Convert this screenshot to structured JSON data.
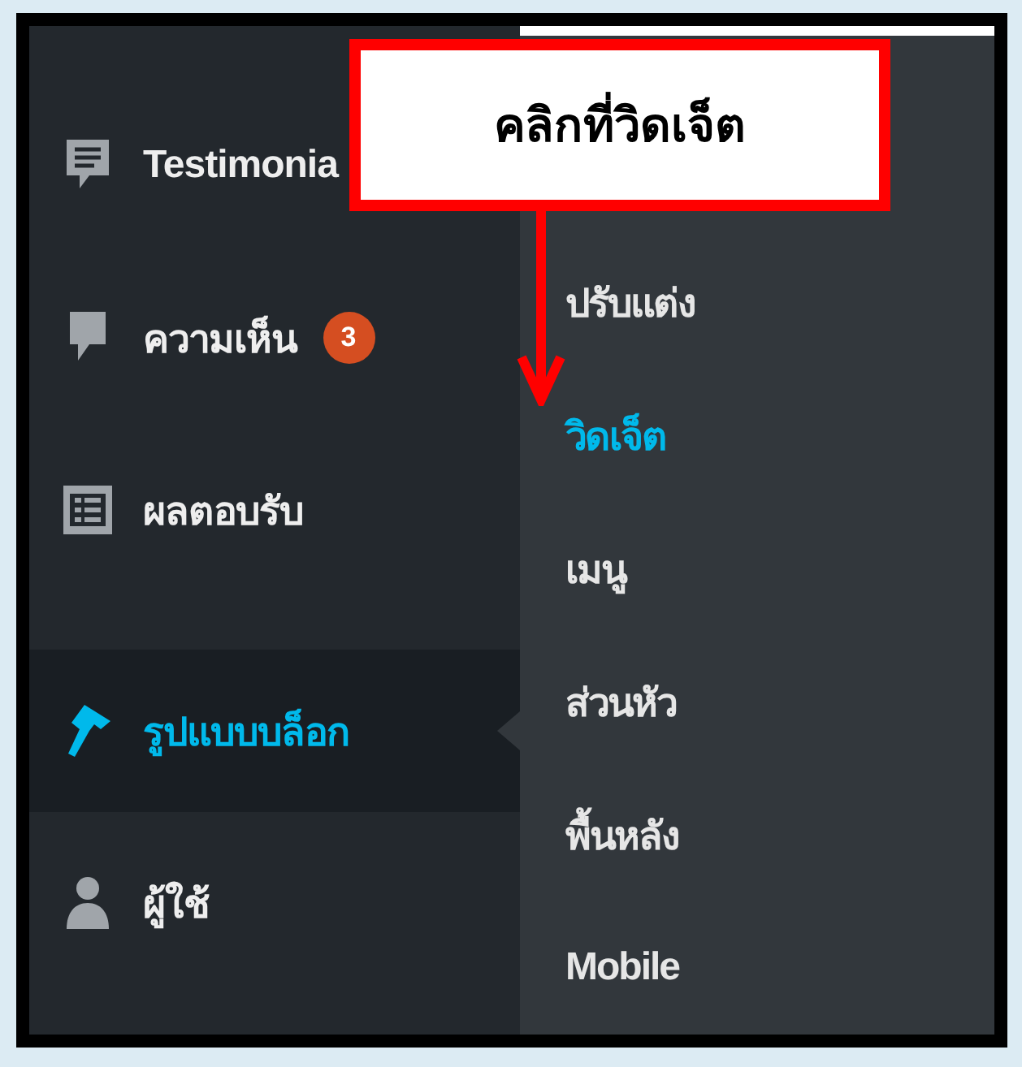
{
  "annotation": {
    "text": "คลิกที่วิดเจ็ต"
  },
  "sidebar": {
    "groups": [
      {
        "items": [
          {
            "label": "Testimonia",
            "kind": "testimonial",
            "selected": false
          },
          {
            "label": "ความเห็น",
            "kind": "comment",
            "badge": "3",
            "selected": false
          },
          {
            "label": "ผลตอบรับ",
            "kind": "form",
            "selected": false
          }
        ]
      },
      {
        "items": [
          {
            "label": "รูปแบบบล็อก",
            "kind": "appearance",
            "selected": true
          },
          {
            "label": "ผู้ใช้",
            "kind": "user",
            "selected": false
          }
        ]
      }
    ]
  },
  "submenu": {
    "items": [
      {
        "label": "ปรับแต่ง",
        "selected": false
      },
      {
        "label": "วิดเจ็ต",
        "selected": true
      },
      {
        "label": "เมนู",
        "selected": false
      },
      {
        "label": "ส่วนหัว",
        "selected": false
      },
      {
        "label": "พื้นหลัง",
        "selected": false
      },
      {
        "label": "Mobile",
        "selected": false
      }
    ]
  }
}
